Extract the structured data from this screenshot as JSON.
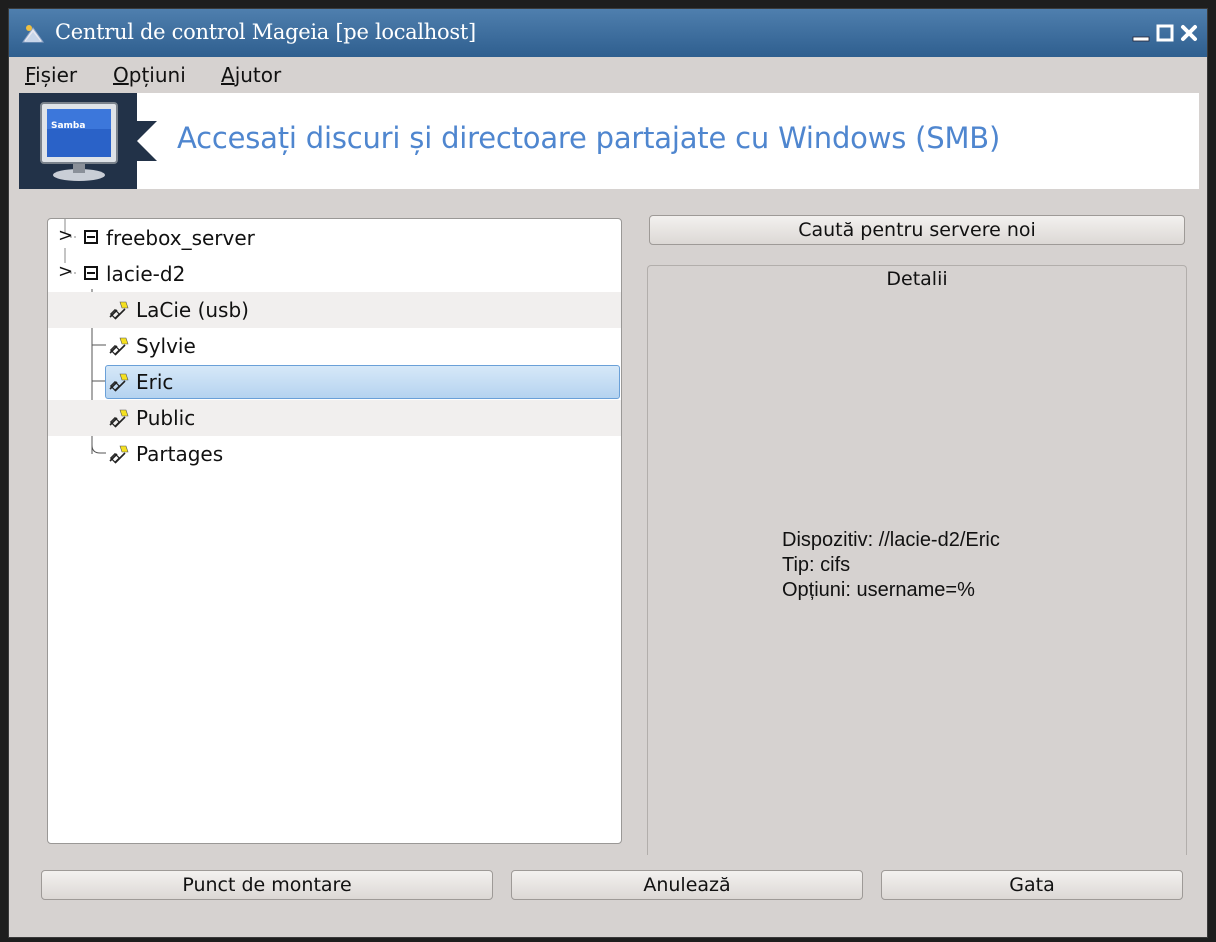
{
  "window": {
    "title": "Centrul de control Mageia  [pe localhost]"
  },
  "menubar": {
    "items": [
      "Fișier",
      "Opțiuni",
      "Ajutor"
    ]
  },
  "banner": {
    "icon_label": "Samba",
    "title": "Accesați discuri și directoare partajate cu Windows (SMB)",
    "title_color": "#4f86cf"
  },
  "tree": {
    "servers": [
      {
        "name": "freebox_server",
        "expander": ">"
      },
      {
        "name": "lacie-d2",
        "expander": ">"
      }
    ],
    "shares": [
      {
        "name": "LaCie (usb)"
      },
      {
        "name": "Sylvie"
      },
      {
        "name": "Eric",
        "selected": true
      },
      {
        "name": "Public"
      },
      {
        "name": "Partages"
      }
    ]
  },
  "search_button": "Caută pentru servere noi",
  "details": {
    "title": "Detalii",
    "device": "Dispozitiv: //lacie-d2/Eric",
    "type": "Tip: cifs",
    "options": "Opțiuni: username=%"
  },
  "buttons": {
    "mount_point": "Punct de montare",
    "cancel": "Anulează",
    "done": "Gata"
  },
  "colors": {
    "titlebar": "#3b6b9b",
    "selection": "#b5d3f0",
    "window_bg": "#d6d2d0"
  }
}
